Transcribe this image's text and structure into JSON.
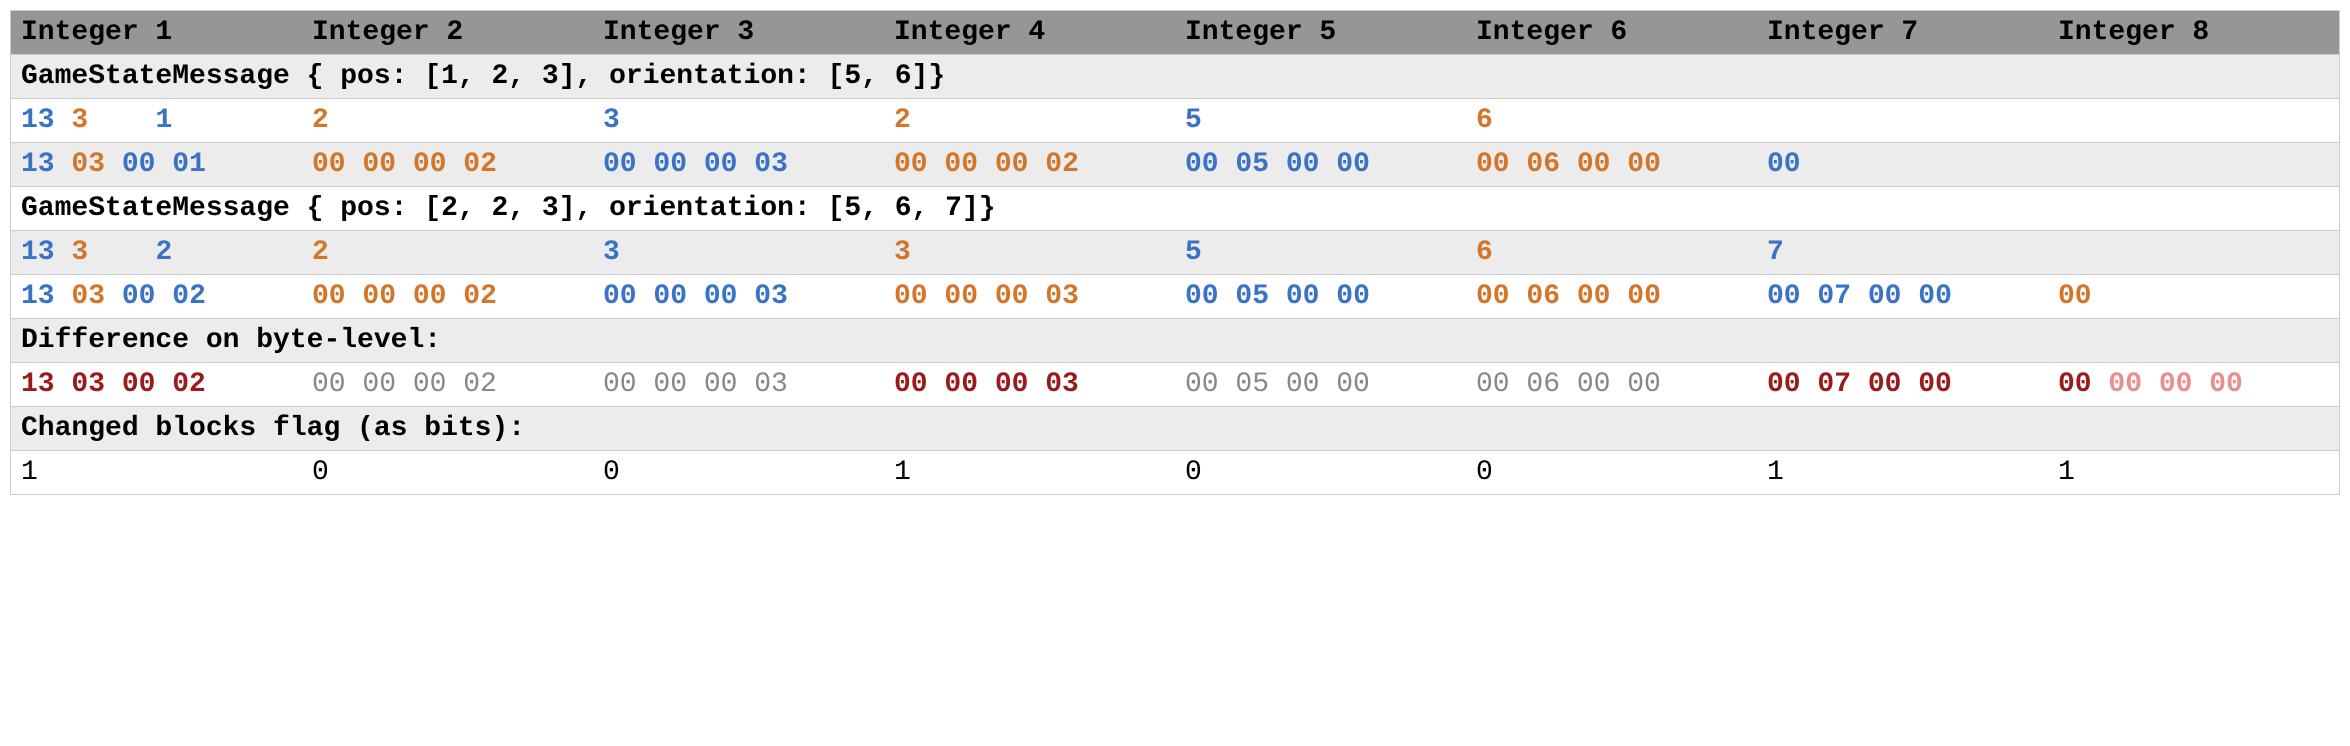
{
  "headers": [
    "Integer 1",
    "Integer 2",
    "Integer 3",
    "Integer 4",
    "Integer 5",
    "Integer 6",
    "Integer 7",
    "Integer 8"
  ],
  "msg1": {
    "title": "GameStateMessage { pos: [1, 2, 3], orientation: [5, 6]}",
    "conceptual": [
      [
        {
          "t": "13",
          "c": "blue"
        },
        {
          "t": " "
        },
        {
          "t": "3",
          "c": "orange"
        },
        {
          "t": "    "
        },
        {
          "t": "1",
          "c": "blue"
        }
      ],
      [
        {
          "t": "2",
          "c": "orange"
        }
      ],
      [
        {
          "t": "3",
          "c": "blue"
        }
      ],
      [
        {
          "t": "2",
          "c": "orange"
        }
      ],
      [
        {
          "t": "5",
          "c": "blue"
        }
      ],
      [
        {
          "t": "6",
          "c": "orange"
        }
      ],
      [],
      []
    ],
    "bytes": [
      [
        {
          "t": "13",
          "c": "blue"
        },
        {
          "t": " "
        },
        {
          "t": "03",
          "c": "orange"
        },
        {
          "t": " "
        },
        {
          "t": "00",
          "c": "blue"
        },
        {
          "t": " "
        },
        {
          "t": "01",
          "c": "blue"
        }
      ],
      [
        {
          "t": "00",
          "c": "orange"
        },
        {
          "t": " "
        },
        {
          "t": "00",
          "c": "orange"
        },
        {
          "t": " "
        },
        {
          "t": "00",
          "c": "orange"
        },
        {
          "t": " "
        },
        {
          "t": "02",
          "c": "orange"
        }
      ],
      [
        {
          "t": "00",
          "c": "blue"
        },
        {
          "t": " "
        },
        {
          "t": "00",
          "c": "blue"
        },
        {
          "t": " "
        },
        {
          "t": "00",
          "c": "blue"
        },
        {
          "t": " "
        },
        {
          "t": "03",
          "c": "blue"
        }
      ],
      [
        {
          "t": "00",
          "c": "orange"
        },
        {
          "t": " "
        },
        {
          "t": "00",
          "c": "orange"
        },
        {
          "t": " "
        },
        {
          "t": "00",
          "c": "orange"
        },
        {
          "t": " "
        },
        {
          "t": "02",
          "c": "orange"
        }
      ],
      [
        {
          "t": "00",
          "c": "blue"
        },
        {
          "t": " "
        },
        {
          "t": "05",
          "c": "blue"
        },
        {
          "t": " "
        },
        {
          "t": "00",
          "c": "blue"
        },
        {
          "t": " "
        },
        {
          "t": "00",
          "c": "blue"
        }
      ],
      [
        {
          "t": "00",
          "c": "orange"
        },
        {
          "t": " "
        },
        {
          "t": "06",
          "c": "orange"
        },
        {
          "t": " "
        },
        {
          "t": "00",
          "c": "orange"
        },
        {
          "t": " "
        },
        {
          "t": "00",
          "c": "orange"
        }
      ],
      [
        {
          "t": "00",
          "c": "blue"
        }
      ],
      []
    ]
  },
  "msg2": {
    "title": "GameStateMessage { pos: [2, 2, 3], orientation: [5, 6, 7]}",
    "conceptual": [
      [
        {
          "t": "13",
          "c": "blue"
        },
        {
          "t": " "
        },
        {
          "t": "3",
          "c": "orange"
        },
        {
          "t": "    "
        },
        {
          "t": "2",
          "c": "blue"
        }
      ],
      [
        {
          "t": "2",
          "c": "orange"
        }
      ],
      [
        {
          "t": "3",
          "c": "blue"
        }
      ],
      [
        {
          "t": "3",
          "c": "orange"
        }
      ],
      [
        {
          "t": "5",
          "c": "blue"
        }
      ],
      [
        {
          "t": "6",
          "c": "orange"
        }
      ],
      [
        {
          "t": "7",
          "c": "blue"
        }
      ],
      []
    ],
    "bytes": [
      [
        {
          "t": "13",
          "c": "blue"
        },
        {
          "t": " "
        },
        {
          "t": "03",
          "c": "orange"
        },
        {
          "t": " "
        },
        {
          "t": "00",
          "c": "blue"
        },
        {
          "t": " "
        },
        {
          "t": "02",
          "c": "blue"
        }
      ],
      [
        {
          "t": "00",
          "c": "orange"
        },
        {
          "t": " "
        },
        {
          "t": "00",
          "c": "orange"
        },
        {
          "t": " "
        },
        {
          "t": "00",
          "c": "orange"
        },
        {
          "t": " "
        },
        {
          "t": "02",
          "c": "orange"
        }
      ],
      [
        {
          "t": "00",
          "c": "blue"
        },
        {
          "t": " "
        },
        {
          "t": "00",
          "c": "blue"
        },
        {
          "t": " "
        },
        {
          "t": "00",
          "c": "blue"
        },
        {
          "t": " "
        },
        {
          "t": "03",
          "c": "blue"
        }
      ],
      [
        {
          "t": "00",
          "c": "orange"
        },
        {
          "t": " "
        },
        {
          "t": "00",
          "c": "orange"
        },
        {
          "t": " "
        },
        {
          "t": "00",
          "c": "orange"
        },
        {
          "t": " "
        },
        {
          "t": "03",
          "c": "orange"
        }
      ],
      [
        {
          "t": "00",
          "c": "blue"
        },
        {
          "t": " "
        },
        {
          "t": "05",
          "c": "blue"
        },
        {
          "t": " "
        },
        {
          "t": "00",
          "c": "blue"
        },
        {
          "t": " "
        },
        {
          "t": "00",
          "c": "blue"
        }
      ],
      [
        {
          "t": "00",
          "c": "orange"
        },
        {
          "t": " "
        },
        {
          "t": "06",
          "c": "orange"
        },
        {
          "t": " "
        },
        {
          "t": "00",
          "c": "orange"
        },
        {
          "t": " "
        },
        {
          "t": "00",
          "c": "orange"
        }
      ],
      [
        {
          "t": "00",
          "c": "blue"
        },
        {
          "t": " "
        },
        {
          "t": "07",
          "c": "blue"
        },
        {
          "t": " "
        },
        {
          "t": "00",
          "c": "blue"
        },
        {
          "t": " "
        },
        {
          "t": "00",
          "c": "blue"
        }
      ],
      [
        {
          "t": "00",
          "c": "orange"
        }
      ]
    ]
  },
  "diff": {
    "title": "Difference on byte-level:",
    "bytes": [
      [
        {
          "t": "13 03 00 02",
          "c": "darkred"
        }
      ],
      [
        {
          "t": "00 00 00 02",
          "c": "grey"
        }
      ],
      [
        {
          "t": "00 00 00 03",
          "c": "grey"
        }
      ],
      [
        {
          "t": "00 00 00 03",
          "c": "darkred"
        }
      ],
      [
        {
          "t": "00 05 00 00",
          "c": "grey"
        }
      ],
      [
        {
          "t": "00 06 00 00",
          "c": "grey"
        }
      ],
      [
        {
          "t": "00 07 00 00",
          "c": "darkred"
        }
      ],
      [
        {
          "t": "00",
          "c": "darkred"
        },
        {
          "t": " "
        },
        {
          "t": "00 00 00",
          "c": "lightred"
        }
      ]
    ]
  },
  "flags": {
    "title": "Changed blocks flag (as bits):",
    "bits": [
      "1",
      "0",
      "0",
      "1",
      "0",
      "0",
      "1",
      "1"
    ]
  }
}
